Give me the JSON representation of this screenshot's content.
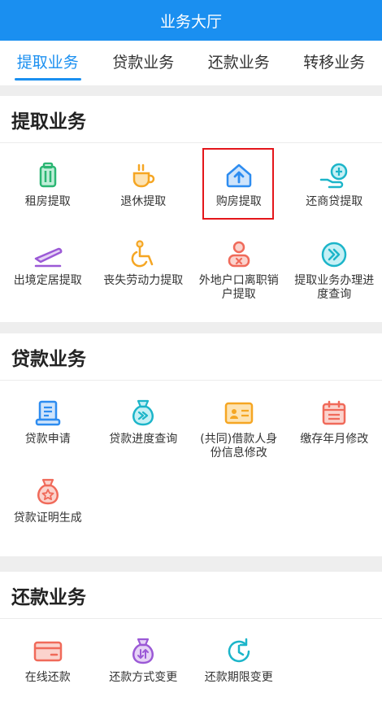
{
  "header": {
    "title": "业务大厅"
  },
  "tabs": [
    {
      "label": "提取业务"
    },
    {
      "label": "贷款业务"
    },
    {
      "label": "还款业务"
    },
    {
      "label": "转移业务"
    }
  ],
  "sections": [
    {
      "title": "提取业务",
      "items": [
        {
          "label": "租房提取",
          "icon": "luggage-icon",
          "color": "#2bb673"
        },
        {
          "label": "退休提取",
          "icon": "coffee-cup-icon",
          "color": "#f5a623"
        },
        {
          "label": "购房提取",
          "icon": "house-upload-icon",
          "color": "#2d8cf0"
        },
        {
          "label": "还商贷提取",
          "icon": "hand-coin-icon",
          "color": "#1cb5c9"
        },
        {
          "label": "出境定居提取",
          "icon": "plane-icon",
          "color": "#9b59d6"
        },
        {
          "label": "丧失劳动力提取",
          "icon": "wheelchair-icon",
          "color": "#f5a623"
        },
        {
          "label": "外地户口离职销户提取",
          "icon": "user-remove-icon",
          "color": "#f06a5a"
        },
        {
          "label": "提取业务办理进度查询",
          "icon": "double-arrow-icon",
          "color": "#1cb5c9"
        }
      ]
    },
    {
      "title": "贷款业务",
      "items": [
        {
          "label": "贷款申请",
          "icon": "form-icon",
          "color": "#2d8cf0"
        },
        {
          "label": "贷款进度查询",
          "icon": "money-bag-icon",
          "color": "#1cb5c9"
        },
        {
          "label": "(共同)借款人身份信息修改",
          "icon": "id-card-icon",
          "color": "#f5a623"
        },
        {
          "label": "缴存年月修改",
          "icon": "calendar-icon",
          "color": "#f06a5a"
        },
        {
          "label": "贷款证明生成",
          "icon": "star-bag-icon",
          "color": "#f06a5a"
        }
      ]
    },
    {
      "title": "还款业务",
      "items": [
        {
          "label": "在线还款",
          "icon": "card-icon",
          "color": "#f06a5a"
        },
        {
          "label": "还款方式变更",
          "icon": "exchange-bag-icon",
          "color": "#9b59d6"
        },
        {
          "label": "还款期限变更",
          "icon": "clock-refresh-icon",
          "color": "#1cb5c9"
        }
      ]
    }
  ]
}
